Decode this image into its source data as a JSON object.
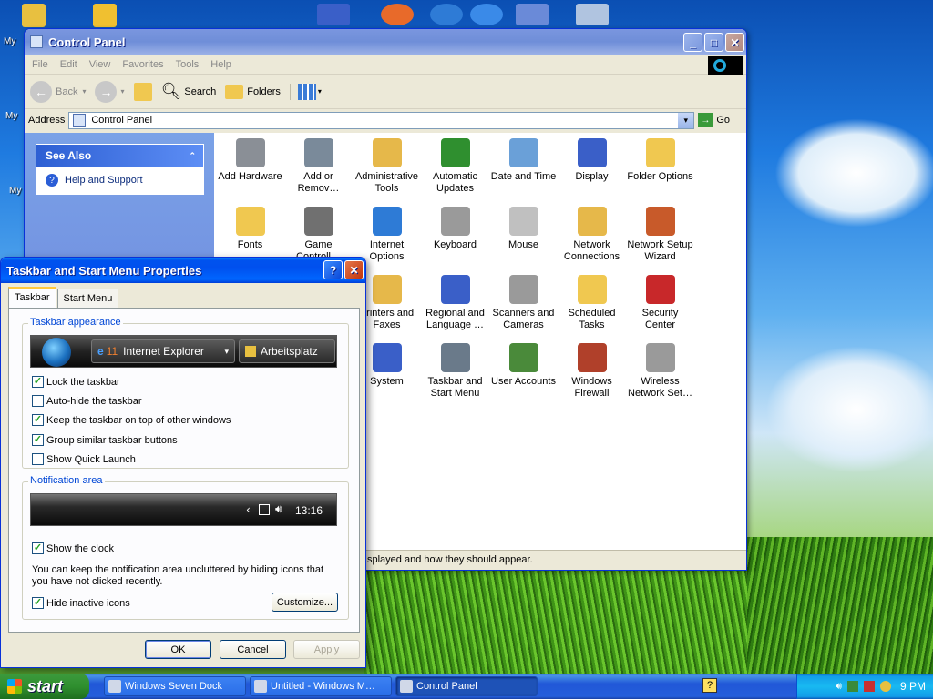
{
  "desktop": {
    "icons": [
      {
        "label": "My"
      },
      {
        "label": "My"
      },
      {
        "label": "My"
      }
    ]
  },
  "control_panel": {
    "title": "Control Panel",
    "menu": [
      "File",
      "Edit",
      "View",
      "Favorites",
      "Tools",
      "Help"
    ],
    "toolbar": {
      "back": "Back",
      "search": "Search",
      "folders": "Folders"
    },
    "address_label": "Address",
    "address_value": "Control Panel",
    "go_label": "Go",
    "see_also": {
      "header": "See Also",
      "link": "Help and Support"
    },
    "items": [
      {
        "label": "Add Hardware",
        "icon": "add-hardware-icon",
        "color": "#8a8f96"
      },
      {
        "label": "Add or Remov…",
        "icon": "add-remove-programs-icon",
        "color": "#7a8a9a"
      },
      {
        "label": "Administrative Tools",
        "icon": "administrative-tools-icon",
        "color": "#e6b84a"
      },
      {
        "label": "Automatic Updates",
        "icon": "automatic-updates-icon",
        "color": "#2f8f2f"
      },
      {
        "label": "Date and Time",
        "icon": "date-time-icon",
        "color": "#6aa0d8"
      },
      {
        "label": "Display",
        "icon": "display-icon",
        "color": "#3a5fc8"
      },
      {
        "label": "Folder Options",
        "icon": "folder-options-icon",
        "color": "#f0c850"
      },
      {
        "label": "Fonts",
        "icon": "fonts-icon",
        "color": "#f0c850"
      },
      {
        "label": "Game Controll…",
        "icon": "game-controllers-icon",
        "color": "#707070"
      },
      {
        "label": "Internet Options",
        "icon": "internet-options-icon",
        "color": "#2e7bd6"
      },
      {
        "label": "Keyboard",
        "icon": "keyboard-icon",
        "color": "#9a9a9a"
      },
      {
        "label": "Mouse",
        "icon": "mouse-icon",
        "color": "#c0c0c0"
      },
      {
        "label": "Network Connections",
        "icon": "network-connections-icon",
        "color": "#e6b84a"
      },
      {
        "label": "Network Setup Wizard",
        "icon": "network-setup-icon",
        "color": "#c85a2a"
      },
      {
        "label": "Printers and Faxes",
        "icon": "printers-faxes-icon",
        "color": "#e6b84a"
      },
      {
        "label": "Regional and Language …",
        "icon": "regional-language-icon",
        "color": "#3a5fc8"
      },
      {
        "label": "Scanners and Cameras",
        "icon": "scanners-cameras-icon",
        "color": "#9a9a9a"
      },
      {
        "label": "Scheduled Tasks",
        "icon": "scheduled-tasks-icon",
        "color": "#f0c850"
      },
      {
        "label": "Security Center",
        "icon": "security-center-icon",
        "color": "#c8282a"
      },
      {
        "label": "System",
        "icon": "system-icon",
        "color": "#3a5fc8"
      },
      {
        "label": "Taskbar and Start Menu",
        "icon": "taskbar-start-menu-icon",
        "color": "#6a7a8a"
      },
      {
        "label": "User Accounts",
        "icon": "user-accounts-icon",
        "color": "#4a8a3a"
      },
      {
        "label": "Windows Firewall",
        "icon": "windows-firewall-icon",
        "color": "#b0402a"
      },
      {
        "label": "Wireless Network Set…",
        "icon": "wireless-network-icon",
        "color": "#9a9a9a"
      }
    ],
    "status_text": "splayed and how they should appear."
  },
  "dialog": {
    "title": "Taskbar and Start Menu Properties",
    "tabs": [
      "Taskbar",
      "Start Menu"
    ],
    "taskbar_group": "Taskbar appearance",
    "preview_ie": "Internet Explorer",
    "preview_ie_count": "11",
    "preview_folder": "Arbeitsplatz",
    "options": [
      {
        "label": "Lock the taskbar",
        "checked": true
      },
      {
        "label": "Auto-hide the taskbar",
        "checked": false
      },
      {
        "label": "Keep the taskbar on top of other windows",
        "checked": true
      },
      {
        "label": "Group similar taskbar buttons",
        "checked": true
      },
      {
        "label": "Show Quick Launch",
        "checked": false
      }
    ],
    "notification_group": "Notification area",
    "clock_preview": "13:16",
    "show_clock": "Show the clock",
    "help_text": "You can keep the notification area uncluttered by hiding icons that you have not clicked recently.",
    "hide_inactive": "Hide inactive icons",
    "customize": "Customize...",
    "ok": "OK",
    "cancel": "Cancel",
    "apply": "Apply"
  },
  "taskbar": {
    "start": "start",
    "tasks": [
      {
        "label": "Windows Seven Dock",
        "active": false
      },
      {
        "label": "Untitled - Windows M…",
        "active": false
      },
      {
        "label": "Control Panel",
        "active": true
      }
    ],
    "clock": "9 PM"
  }
}
